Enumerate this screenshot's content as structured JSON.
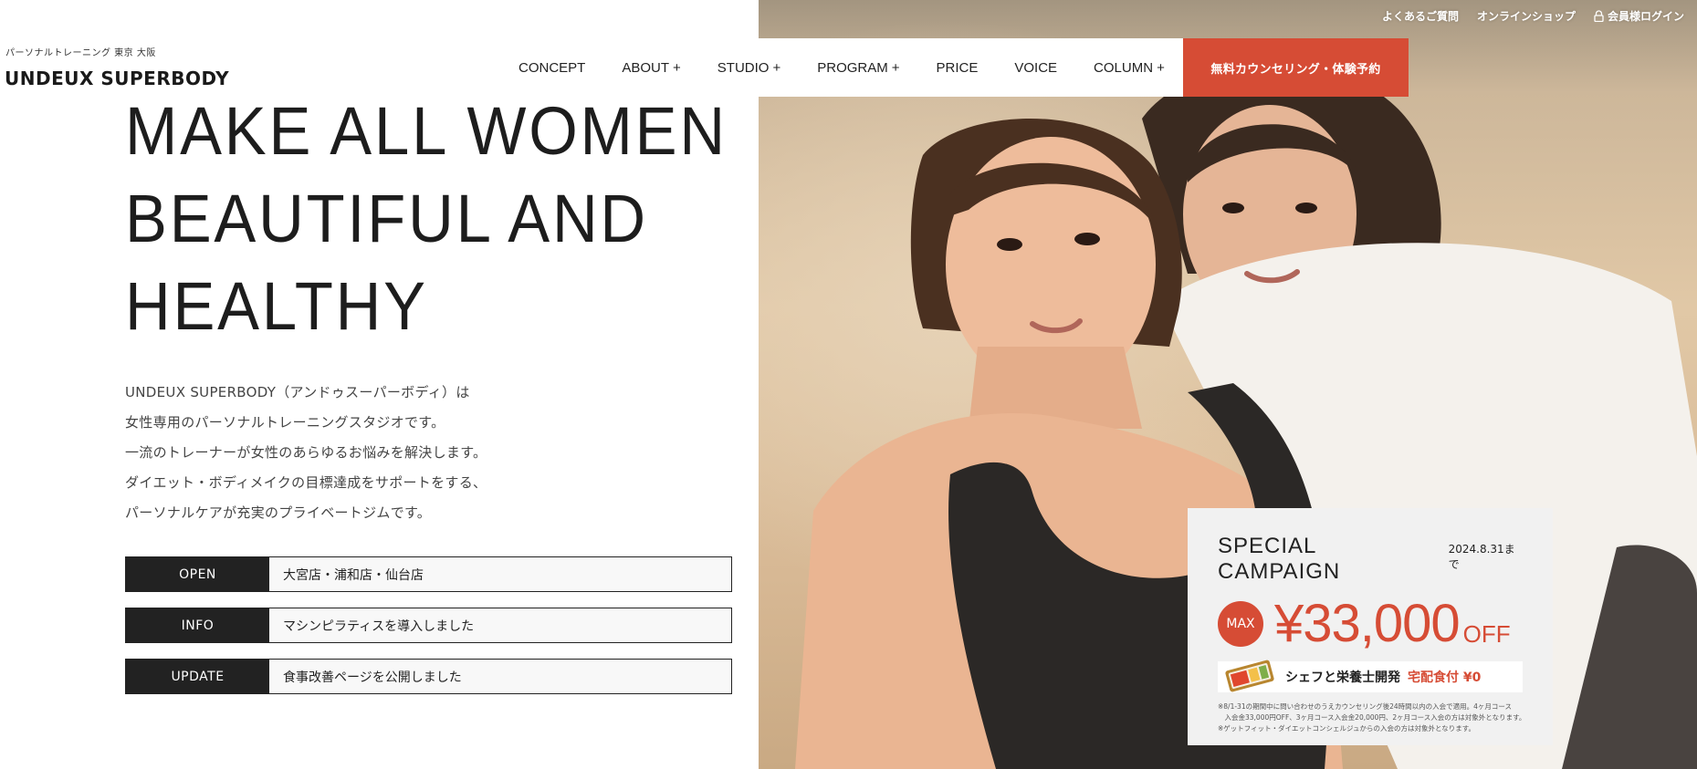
{
  "brand": {
    "tagline": "パーソナルトレーニング 東京 大阪",
    "logo": "UNDEUX SUPERBODY"
  },
  "utility_nav": [
    {
      "label": "よくあるご質問"
    },
    {
      "label": "オンラインショップ"
    },
    {
      "label": "会員様ログイン",
      "icon": "lock-icon"
    }
  ],
  "main_nav": [
    {
      "label": "CONCEPT",
      "has_submenu": false
    },
    {
      "label": "ABOUT",
      "has_submenu": true
    },
    {
      "label": "STUDIO",
      "has_submenu": true
    },
    {
      "label": "PROGRAM",
      "has_submenu": true
    },
    {
      "label": "PRICE",
      "has_submenu": false
    },
    {
      "label": "VOICE",
      "has_submenu": false
    },
    {
      "label": "COLUMN",
      "has_submenu": true
    }
  ],
  "cta": {
    "label": "無料カウンセリング・体験予約"
  },
  "hero": {
    "heading_lines": [
      "MAKE ALL WOMEN",
      "BEAUTIFUL AND",
      "HEALTHY"
    ],
    "lead_lines": [
      "UNDEUX SUPERBODY（アンドゥスーパーボディ）は",
      "女性専用のパーソナルトレーニングスタジオです。",
      "一流のトレーナーが女性のあらゆるお悩みを解決します。",
      "ダイエット・ボディメイクの目標達成をサポートをする、",
      "パーソナルケアが充実のプライベートジムです。"
    ]
  },
  "news": [
    {
      "tag": "OPEN",
      "text": "大宮店・浦和店・仙台店"
    },
    {
      "tag": "INFO",
      "text": "マシンピラティスを導入しました"
    },
    {
      "tag": "UPDATE",
      "text": "食事改善ページを公開しました"
    }
  ],
  "campaign": {
    "title": "SPECIAL CAMPAIGN",
    "deadline": "2024.8.31まで",
    "badge": "MAX",
    "price": "¥33,000",
    "off": "OFF",
    "bento_text": "シェフと栄養士開発",
    "bento_accent": "宅配食付 ¥0",
    "notes": [
      "※8/1-31の期間中に問い合わせのうえカウンセリング後24時間以内の入会で適用。4ヶ月コース",
      "　入会金33,000円OFF、3ヶ月コース入会金20,000円、2ヶ月コース入会の方は対象外となります。",
      "※ゲットフィット・ダイエットコンシェルジュからの入会の方は対象外となります。"
    ]
  },
  "colors": {
    "accent": "#d64c35",
    "dark": "#222222"
  }
}
